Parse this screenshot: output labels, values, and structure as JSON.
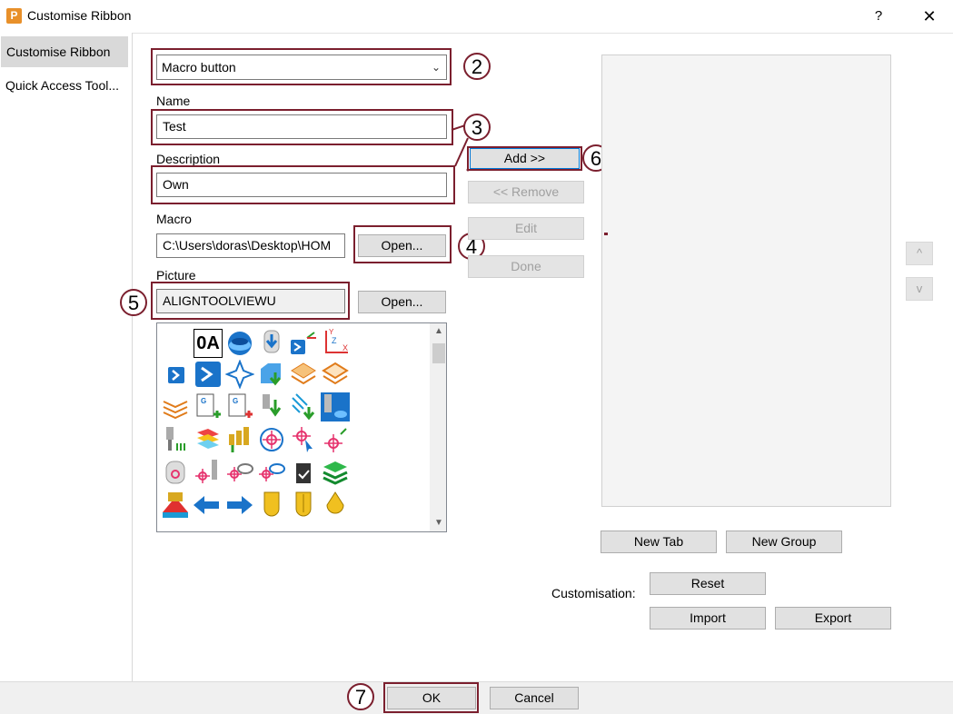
{
  "window": {
    "title": "Customise Ribbon",
    "help": "?",
    "close": "✕",
    "app_icon": "P"
  },
  "sidebar": {
    "items": [
      {
        "label": "Customise Ribbon"
      },
      {
        "label": "Quick Access Tool..."
      }
    ]
  },
  "form": {
    "type_select": {
      "value": "Macro button"
    },
    "name": {
      "label": "Name",
      "value": "Test"
    },
    "description": {
      "label": "Description",
      "value": "Own"
    },
    "macro": {
      "label": "Macro",
      "value": "C:\\Users\\doras\\Desktop\\HOM",
      "open": "Open..."
    },
    "picture": {
      "label": "Picture",
      "value": "ALIGNTOOLVIEWU",
      "open": "Open..."
    }
  },
  "actions": {
    "add": "Add >>",
    "remove": "<< Remove",
    "edit": "Edit",
    "done": "Done"
  },
  "move": {
    "up": "^",
    "down": "v"
  },
  "tabs": {
    "new_tab": "New Tab",
    "new_group": "New Group"
  },
  "customisation": {
    "label": "Customisation:",
    "reset": "Reset",
    "import": "Import",
    "export": "Export"
  },
  "footer": {
    "ok": "OK",
    "cancel": "Cancel"
  },
  "callouts": {
    "c2": "2",
    "c3": "3",
    "c4": "4",
    "c5": "5",
    "c6": "6",
    "c7": "7"
  },
  "gallery": {
    "sample_text": "0A"
  },
  "colors": {
    "highlight": "#7b1f2e",
    "accent": "#0078d7"
  }
}
